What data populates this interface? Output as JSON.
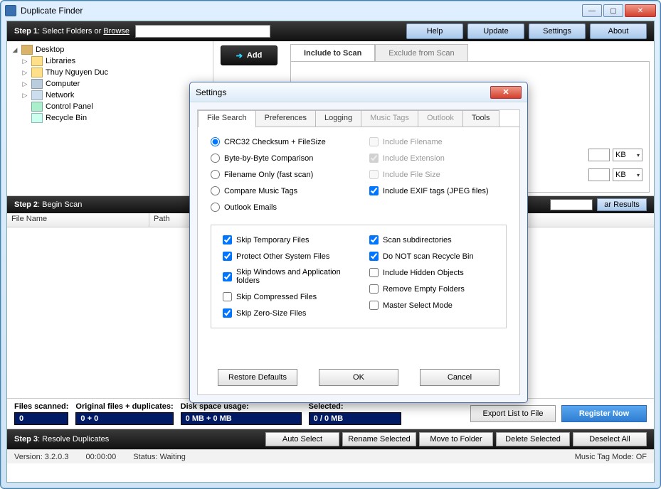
{
  "app_title": "Duplicate Finder",
  "step1": {
    "label_prefix": "Step 1",
    "label_rest": ": Select Folders or ",
    "browse": "Browse"
  },
  "toolbar": {
    "help": "Help",
    "update": "Update",
    "settings": "Settings",
    "about": "About"
  },
  "tree": {
    "root": "Desktop",
    "items": [
      "Libraries",
      "Thuy Nguyen Duc",
      "Computer",
      "Network",
      "Control Panel",
      "Recycle Bin"
    ]
  },
  "add_button": "Add",
  "scan_tabs": {
    "include": "Include to Scan",
    "exclude": "Exclude from Scan"
  },
  "size_unit": "KB",
  "step2": {
    "label_prefix": "Step 2",
    "label_rest": ": Begin Scan",
    "clear": "ar Results"
  },
  "results_cols": {
    "filename": "File Name",
    "path": "Path"
  },
  "stats": {
    "scanned_label": "Files scanned:",
    "scanned_val": "0",
    "orig_label": "Original files + duplicates:",
    "orig_val": "0 + 0",
    "disk_label": "Disk space usage:",
    "disk_val": "0 MB + 0 MB",
    "sel_label": "Selected:",
    "sel_val": "0 / 0 MB",
    "export": "Export List to File",
    "register": "Register Now"
  },
  "step3": {
    "label_prefix": "Step 3",
    "label_rest": ": Resolve Duplicates",
    "auto": "Auto Select",
    "rename": "Rename Selected",
    "move": "Move to Folder",
    "delete": "Delete Selected",
    "deselect": "Deselect All"
  },
  "status": {
    "version": "Version: 3.2.0.3",
    "time": "00:00:00",
    "state": "Status: Waiting",
    "music": "Music Tag Mode: OF"
  },
  "dialog": {
    "title": "Settings",
    "tabs": [
      "File Search",
      "Preferences",
      "Logging",
      "Music Tags",
      "Outlook",
      "Tools"
    ],
    "radios": [
      "CRC32 Checksum + FileSize",
      "Byte-by-Byte Comparison",
      "Filename Only (fast scan)",
      "Compare Music Tags",
      "Outlook Emails"
    ],
    "include_checks": [
      "Include Filename",
      "Include Extension",
      "Include File Size",
      "Include EXIF tags (JPEG files)"
    ],
    "opts_left": [
      "Skip Temporary Files",
      "Protect Other System Files",
      "Skip Windows and Application folders",
      "Skip Compressed Files",
      "Skip Zero-Size Files"
    ],
    "opts_right": [
      "Scan subdirectories",
      "Do NOT scan Recycle Bin",
      "Include Hidden Objects",
      "Remove Empty Folders",
      "Master Select Mode"
    ],
    "restore": "Restore Defaults",
    "ok": "OK",
    "cancel": "Cancel"
  }
}
